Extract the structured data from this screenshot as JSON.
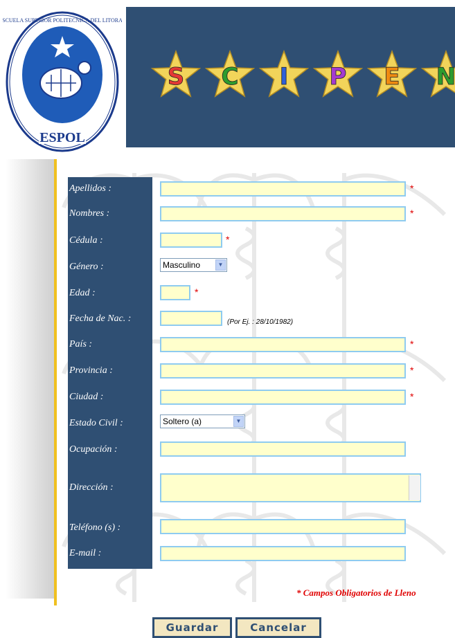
{
  "logo": {
    "text_top": "ESCUELA SUPERIOR POLITECNICA DEL LITORAL",
    "text_bottom": "ESPOL"
  },
  "banner": {
    "letters": [
      "S",
      "C",
      "I",
      "P",
      "E",
      "N"
    ],
    "colors": {
      "star": "#f2d45a",
      "S": "#e53935",
      "C": "#2e9c2e",
      "I": "#2f5fd8",
      "P": "#a43bd0",
      "E": "#f08b10",
      "N": "#2e9c2e"
    }
  },
  "form": {
    "labels": {
      "apellidos": "Apellidos :",
      "nombres": "Nombres :",
      "cedula": "Cédula :",
      "genero": "Género :",
      "edad": "Edad :",
      "fecha_nac": "Fecha de Nac. :",
      "pais": "País :",
      "provincia": "Provincia :",
      "ciudad": "Ciudad :",
      "estado_civil": "Estado Civil :",
      "ocupacion": "Ocupación :",
      "direccion": "Dirección :",
      "telefono": "Teléfono (s) :",
      "email": "E-mail :"
    },
    "required_mark": "*",
    "genero_value": "Masculino",
    "estado_civil_value": "Soltero (a)",
    "fecha_hint": "(Por Ej. : 28/10/1982)",
    "required_note": "* Campos Obligatorios de Lleno"
  },
  "buttons": {
    "save": "Guardar",
    "cancel": "Cancelar"
  },
  "colors": {
    "navy": "#2f4f73",
    "input_bg": "#ffffcc",
    "input_border": "#8ecbf0",
    "required": "#e00000",
    "gold": "#f0c020"
  }
}
